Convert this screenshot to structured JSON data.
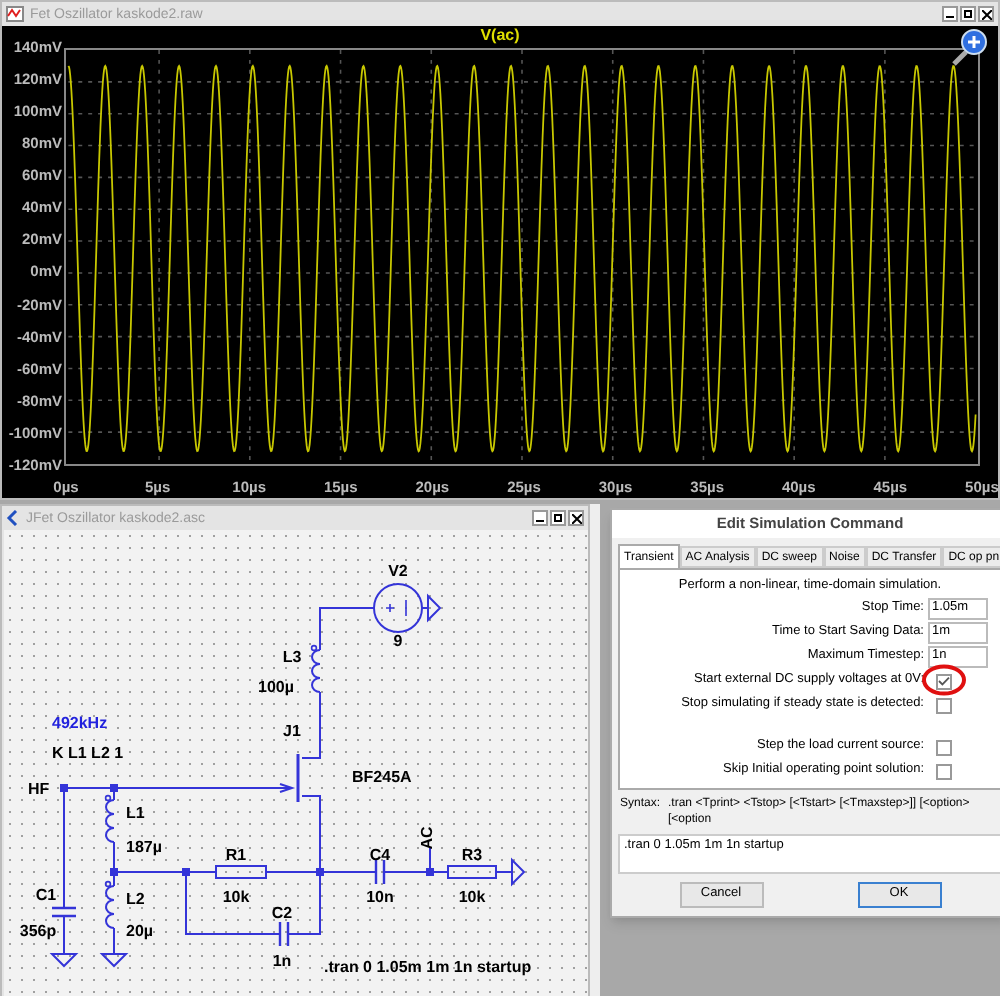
{
  "waveform_window": {
    "title": "Fet Oszillator kaskode2.raw",
    "trace_label": "V(ac)",
    "y_axis_labels": [
      "140mV",
      "120mV",
      "100mV",
      "80mV",
      "60mV",
      "40mV",
      "20mV",
      "0mV",
      "-20mV",
      "-40mV",
      "-60mV",
      "-80mV",
      "-100mV",
      "-120mV"
    ],
    "x_axis_labels": [
      "0µs",
      "5µs",
      "10µs",
      "15µs",
      "20µs",
      "25µs",
      "30µs",
      "35µs",
      "40µs",
      "45µs",
      "50µs"
    ]
  },
  "schematic_window": {
    "title": "JFet Oszillator kaskode2.asc",
    "labels": [
      {
        "text": "V2",
        "kind": "text"
      },
      {
        "text": "9",
        "kind": "text"
      },
      {
        "text": "L3",
        "kind": "text"
      },
      {
        "text": "100µ",
        "kind": "text"
      },
      {
        "text": "492kHz",
        "kind": "comment"
      },
      {
        "text": "J1",
        "kind": "text"
      },
      {
        "text": "K L1 L2 1",
        "kind": "text"
      },
      {
        "text": "BF245A",
        "kind": "text"
      },
      {
        "text": "HF",
        "kind": "text"
      },
      {
        "text": "L1",
        "kind": "text"
      },
      {
        "text": "AC",
        "kind": "vertical"
      },
      {
        "text": "187µ",
        "kind": "text"
      },
      {
        "text": "R1",
        "kind": "text"
      },
      {
        "text": "C4",
        "kind": "text"
      },
      {
        "text": "R3",
        "kind": "text"
      },
      {
        "text": "C1",
        "kind": "text"
      },
      {
        "text": "L2",
        "kind": "text"
      },
      {
        "text": "10k",
        "kind": "text"
      },
      {
        "text": "10n",
        "kind": "text"
      },
      {
        "text": "10k",
        "kind": "text"
      },
      {
        "text": "C2",
        "kind": "text"
      },
      {
        "text": "356p",
        "kind": "text"
      },
      {
        "text": "20µ",
        "kind": "text"
      },
      {
        "text": "1n",
        "kind": "text"
      },
      {
        "text": ".tran 0 1.05m 1m 1n startup",
        "kind": "text"
      }
    ]
  },
  "dialog": {
    "title": "Edit Simulation Command",
    "tabs": [
      {
        "label": "Transient",
        "selected": true
      },
      {
        "label": "AC Analysis",
        "selected": false
      },
      {
        "label": "DC sweep",
        "selected": false
      },
      {
        "label": "Noise",
        "selected": false
      },
      {
        "label": "DC Transfer",
        "selected": false
      },
      {
        "label": "DC op pn",
        "selected": false
      }
    ],
    "description": "Perform a non-linear, time-domain simulation.",
    "fields": [
      {
        "label": "Stop Time:",
        "value": "1.05m"
      },
      {
        "label": "Time to Start Saving Data:",
        "value": "1m"
      },
      {
        "label": "Maximum Timestep:",
        "value": "1n"
      }
    ],
    "checkboxes": [
      {
        "label": "Start external DC supply voltages at 0V:",
        "checked": true,
        "highlighted": true
      },
      {
        "label": "Stop simulating if steady state is detected:",
        "checked": false,
        "highlighted": false
      },
      {
        "label": "Step the load current source:",
        "checked": false,
        "highlighted": false
      },
      {
        "label": "Skip Initial operating point solution:",
        "checked": false,
        "highlighted": false
      }
    ],
    "syntax_label": "Syntax:",
    "syntax": ".tran <Tprint> <Tstop> [<Tstart> [<Tmaxstep>]] [<option> [<option",
    "command": ".tran 0 1.05m 1m 1n startup",
    "buttons": [
      "Cancel",
      "OK"
    ]
  }
}
